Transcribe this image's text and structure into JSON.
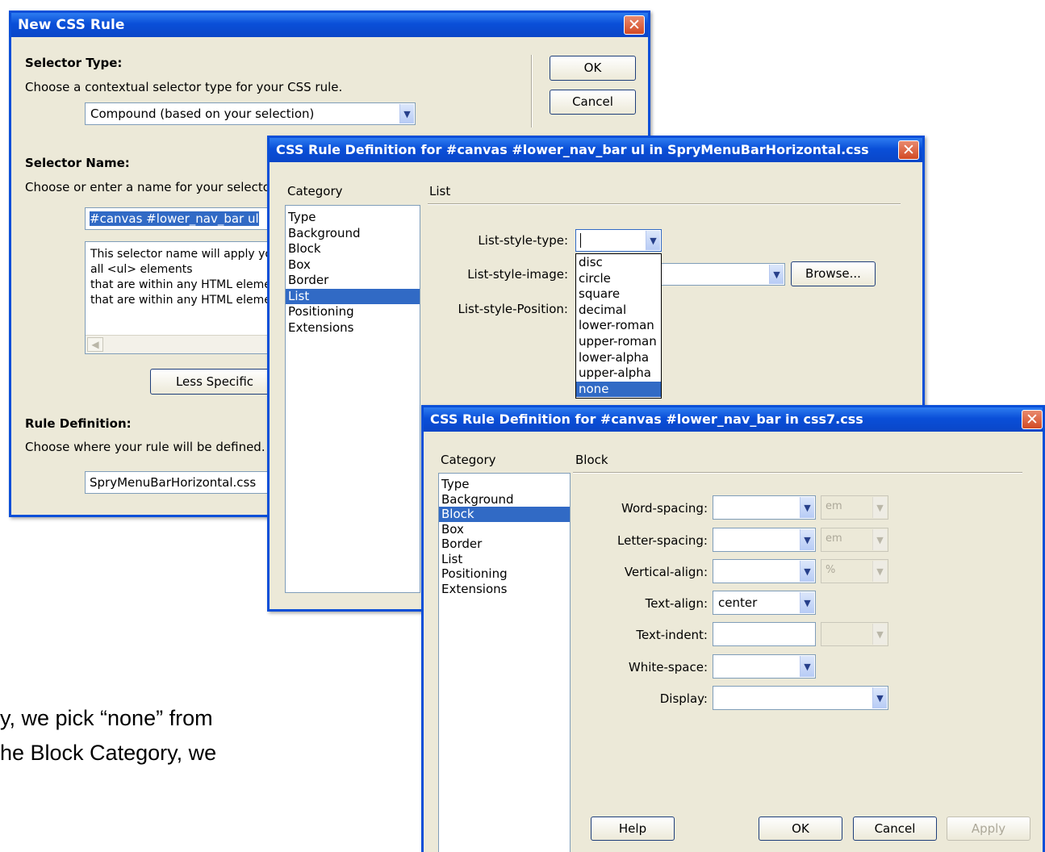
{
  "background_text": {
    "line1": "y, we pick “none” from",
    "line2": "he Block Category, we"
  },
  "new_css_rule": {
    "title": "New CSS Rule",
    "selector_type_heading": "Selector Type:",
    "selector_type_desc": "Choose a contextual selector type for your CSS rule.",
    "selector_type_value": "Compound (based on your selection)",
    "selector_name_heading": "Selector Name:",
    "selector_name_desc": "Choose or enter a name for your selector.",
    "selector_name_value": "#canvas #lower_nav_bar ul",
    "preview_lines": [
      "This selector name will apply yo",
      "all <ul> elements",
      "that are within any HTML eleme",
      "that are within any HTML eleme"
    ],
    "less_specific_label": "Less Specific",
    "rule_definition_heading": "Rule Definition:",
    "rule_definition_desc": "Choose where your rule will be defined.",
    "rule_definition_value": "SpryMenuBarHorizontal.css",
    "ok_label": "OK",
    "cancel_label": "Cancel"
  },
  "list_dialog": {
    "title": "CSS Rule Definition for #canvas #lower_nav_bar ul in SpryMenuBarHorizontal.css",
    "category_label": "Category",
    "categories": [
      "Type",
      "Background",
      "Block",
      "Box",
      "Border",
      "List",
      "Positioning",
      "Extensions"
    ],
    "selected_category": "List",
    "panel_title": "List",
    "list_style_type_label": "List-style-type:",
    "list_style_image_label": "List-style-image:",
    "list_style_position_label": "List-style-Position:",
    "list_style_type_value": "",
    "browse_label": "Browse...",
    "dropdown_options": [
      "disc",
      "circle",
      "square",
      "decimal",
      "lower-roman",
      "upper-roman",
      "lower-alpha",
      "upper-alpha",
      "none"
    ],
    "dropdown_selected": "none"
  },
  "block_dialog": {
    "title": "CSS Rule Definition for #canvas #lower_nav_bar in css7.css",
    "category_label": "Category",
    "categories": [
      "Type",
      "Background",
      "Block",
      "Box",
      "Border",
      "List",
      "Positioning",
      "Extensions"
    ],
    "selected_category": "Block",
    "panel_title": "Block",
    "word_spacing_label": "Word-spacing:",
    "word_spacing_unit": "em",
    "letter_spacing_label": "Letter-spacing:",
    "letter_spacing_unit": "em",
    "vertical_align_label": "Vertical-align:",
    "vertical_align_unit": "%",
    "text_align_label": "Text-align:",
    "text_align_value": "center",
    "text_indent_label": "Text-indent:",
    "white_space_label": "White-space:",
    "display_label": "Display:",
    "help_label": "Help",
    "ok_label": "OK",
    "cancel_label": "Cancel",
    "apply_label": "Apply"
  },
  "colors": {
    "titlebar": "#0a4fd8",
    "dialog_bg": "#ece9d8",
    "selection": "#316ac5",
    "close_button": "#d24a24"
  }
}
